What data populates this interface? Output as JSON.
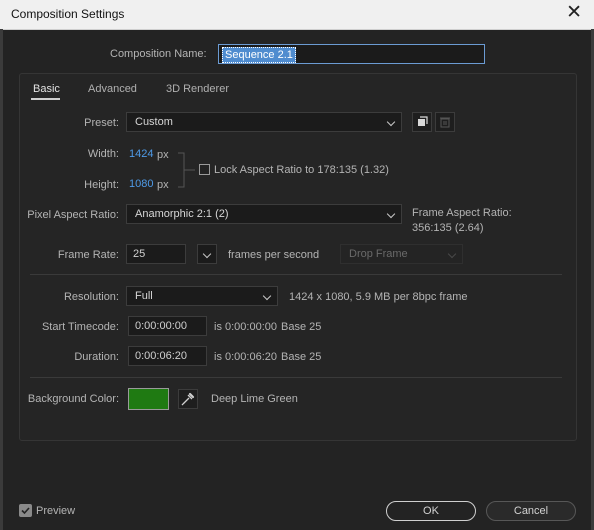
{
  "window": {
    "title": "Composition Settings"
  },
  "composition": {
    "name_label": "Composition Name:",
    "name_value": "Sequence 2.1"
  },
  "tabs": [
    {
      "label": "Basic",
      "active": true
    },
    {
      "label": "Advanced",
      "active": false
    },
    {
      "label": "3D Renderer",
      "active": false
    }
  ],
  "preset": {
    "label": "Preset:",
    "value": "Custom"
  },
  "width": {
    "label": "Width:",
    "value": "1424",
    "unit": "px"
  },
  "height": {
    "label": "Height:",
    "value": "1080",
    "unit": "px"
  },
  "lock_aspect": {
    "label": "Lock Aspect Ratio to 178:135 (1.32)",
    "checked": false
  },
  "pixel_aspect": {
    "label": "Pixel Aspect Ratio:",
    "value": "Anamorphic 2:1 (2)"
  },
  "frame_aspect": {
    "label": "Frame Aspect Ratio:",
    "value": "356:135 (2.64)"
  },
  "frame_rate": {
    "label": "Frame Rate:",
    "value": "25",
    "unit": "frames per second",
    "drop_frame": "Drop Frame"
  },
  "resolution": {
    "label": "Resolution:",
    "value": "Full",
    "info": "1424 x 1080, 5.9 MB per 8bpc frame"
  },
  "start_timecode": {
    "label": "Start Timecode:",
    "value": "0:00:00:00",
    "info": "is 0:00:00:00",
    "base": "Base 25"
  },
  "duration": {
    "label": "Duration:",
    "value": "0:00:06:20",
    "info": "is 0:00:06:20",
    "base": "Base 25"
  },
  "background": {
    "label": "Background Color:",
    "color": "#1f7a12",
    "name": "Deep Lime Green"
  },
  "footer": {
    "preview_label": "Preview",
    "preview_checked": true,
    "ok_label": "OK",
    "cancel_label": "Cancel"
  },
  "colors": {
    "accent_blue": "#4f9be8",
    "selection": "#4f8ccf",
    "dialog_bg": "#232323"
  },
  "icons": {
    "close": "close-icon",
    "save_preset": "save-preset-icon",
    "delete_preset": "trash-icon",
    "eyedropper": "eyedropper-icon",
    "preview_check": "checkmark-icon"
  }
}
